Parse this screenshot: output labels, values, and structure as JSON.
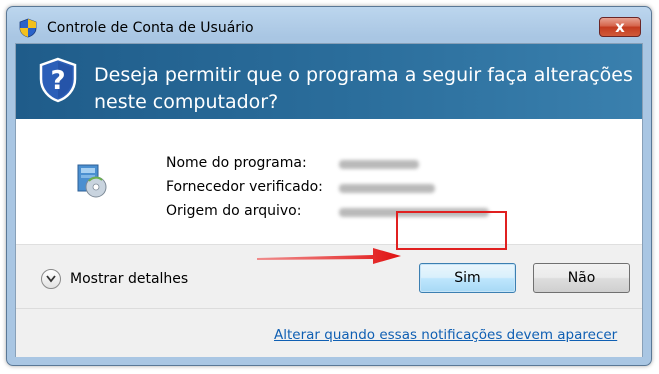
{
  "window": {
    "title": "Controle de Conta de Usuário",
    "close_label": "x"
  },
  "banner": {
    "question": "Deseja permitir que o programa a seguir faça alterações neste computador?"
  },
  "info": {
    "program_name_label": "Nome do programa:",
    "publisher_label": "Fornecedor verificado:",
    "origin_label": "Origem do arquivo:"
  },
  "footer": {
    "details_label": "Mostrar detalhes",
    "yes_label": "Sim",
    "no_label": "Não",
    "notify_link": "Alterar quando essas notificações devem aparecer"
  },
  "colors": {
    "banner": "#2b6e9c",
    "highlight": "#e02020",
    "link": "#0f5fb3"
  }
}
